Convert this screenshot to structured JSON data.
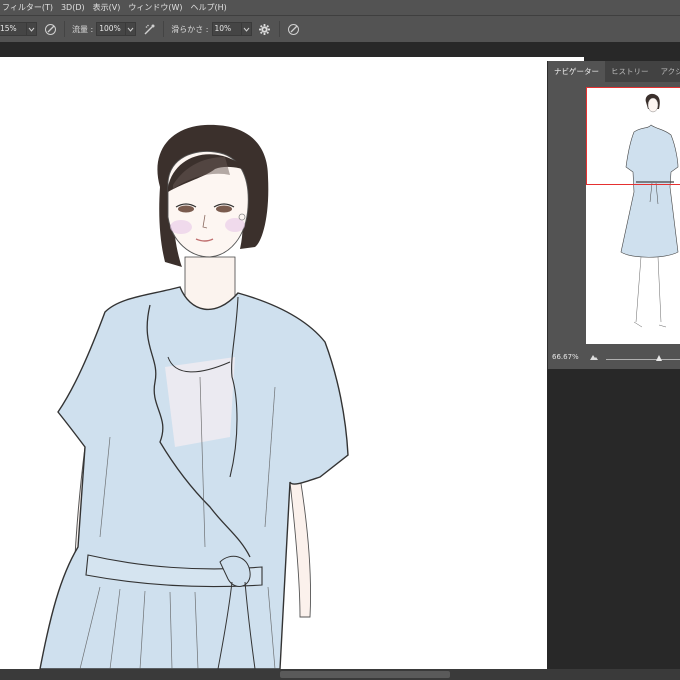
{
  "menubar": {
    "items": [
      "フィルター(T)",
      "3D(D)",
      "表示(V)",
      "ウィンドウ(W)",
      "ヘルプ(H)"
    ]
  },
  "options": {
    "opacity_value": "15%",
    "flow_label": "流量 :",
    "flow_value": "100%",
    "smoothing_label": "滑らかさ :",
    "smoothing_value": "10%"
  },
  "navigator": {
    "tabs": [
      "ナビゲーター",
      "ヒストリー",
      "アクション"
    ],
    "active_tab": 0,
    "zoom": "66.67%",
    "view_box_color": "#e53030"
  },
  "colors": {
    "menubar_bg": "#535353",
    "workspace_bg": "#282828",
    "canvas_bg": "#ffffff",
    "dress_fill": "#cfe0ee"
  }
}
